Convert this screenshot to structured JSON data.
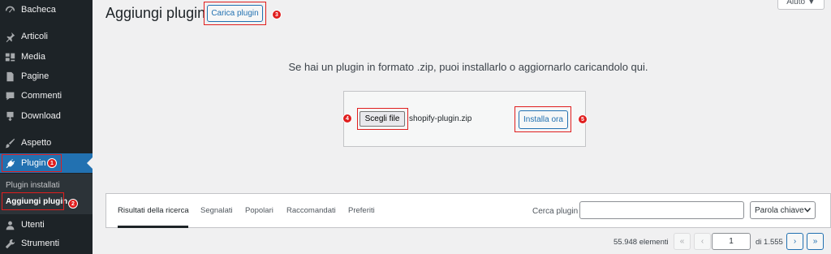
{
  "sidebar": {
    "items": [
      {
        "label": "Bacheca",
        "icon": "dashboard-icon"
      },
      {
        "label": "Articoli",
        "icon": "pin-icon"
      },
      {
        "label": "Media",
        "icon": "media-icon"
      },
      {
        "label": "Pagine",
        "icon": "page-icon"
      },
      {
        "label": "Commenti",
        "icon": "comment-icon"
      },
      {
        "label": "Download",
        "icon": "download-icon"
      },
      {
        "label": "Aspetto",
        "icon": "brush-icon"
      },
      {
        "label": "Plugin",
        "icon": "plugin-icon"
      },
      {
        "label": "Utenti",
        "icon": "user-icon"
      },
      {
        "label": "Strumenti",
        "icon": "wrench-icon"
      }
    ],
    "submenu": {
      "installed": "Plugin installati",
      "add_new": "Aggiungi plugin"
    }
  },
  "header": {
    "title": "Aggiungi plugin",
    "upload_button": "Carica plugin",
    "help": "Aiuto ▼"
  },
  "upload": {
    "intro": "Se hai un plugin in formato .zip, puoi installarlo o aggiornarlo caricandolo qui.",
    "choose_file": "Scegli file",
    "file_name": "shopify-plugin.zip",
    "install_now": "Installa ora"
  },
  "filters": {
    "tabs": [
      "Risultati della ricerca",
      "Segnalati",
      "Popolari",
      "Raccomandati",
      "Preferiti"
    ],
    "search_label": "Cerca plugin",
    "search_value": "",
    "type_select": "Parola chiave"
  },
  "pagination": {
    "count": "55.948 elementi",
    "first": "«",
    "prev": "‹",
    "current_page": "1",
    "total": "di 1.555",
    "next": "›",
    "last": "»"
  },
  "annotations": [
    "1",
    "2",
    "3",
    "4",
    "5"
  ],
  "colors": {
    "sidebar_bg": "#1d2327",
    "active_bg": "#2271b1",
    "highlight": "#e01e1e",
    "accent": "#2271b1"
  }
}
